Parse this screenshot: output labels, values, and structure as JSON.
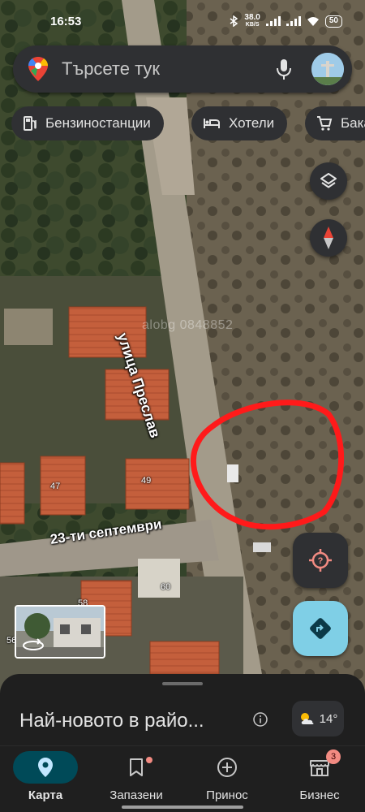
{
  "status_bar": {
    "time": "16:53",
    "speed_value": "38.0",
    "speed_unit": "KB/S",
    "battery": "50"
  },
  "search": {
    "placeholder": "Търсете тук"
  },
  "chips": [
    {
      "label": "Бензиностанции",
      "icon": "gas-station-icon"
    },
    {
      "label": "Хотели",
      "icon": "bed-icon"
    },
    {
      "label": "Бака",
      "icon": "cart-icon"
    }
  ],
  "map": {
    "street_labels": [
      "улица Преслав",
      "23-ти септември"
    ],
    "house_numbers": [
      "47",
      "49",
      "60",
      "58",
      "56"
    ],
    "watermark": "alobg 0848852",
    "annotation_color": "#ff1a1a"
  },
  "sheet": {
    "title": "Най-новото в райо...",
    "weather_temp": "14°"
  },
  "nav": {
    "items": [
      {
        "label": "Карта",
        "icon": "map-pin-icon",
        "active": true
      },
      {
        "label": "Запазени",
        "icon": "bookmark-icon"
      },
      {
        "label": "Принос",
        "icon": "add-circle-icon"
      },
      {
        "label": "Бизнес",
        "icon": "store-icon",
        "badge": "3"
      }
    ]
  },
  "colors": {
    "accent": "#7fcfe6",
    "surface": "#2f3033",
    "active_pill": "#004a58",
    "annotation": "#ff1a1a"
  }
}
